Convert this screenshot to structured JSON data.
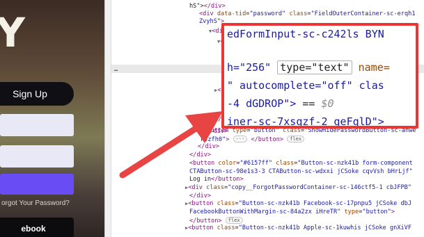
{
  "left_page": {
    "logo_text": "Y",
    "signup_label": "Sign Up",
    "forgot_label": "orgot Your Password?",
    "facebook_label": "ebook"
  },
  "devtools": {
    "lines": [
      {
        "html": "<span class='txt'>hS\"></span><span class='tag'>&lt;/div&gt;</span>"
      },
      {
        "html": "<span class='tag'>&lt;div </span><span class='attr'>data-tid</span>=<span class='val'>\"password\"</span> <span class='attr'>class</span>=<span class='val'>\"FieldOuterContainer-sc-erqh1</span>"
      },
      {
        "html": "<span class='val'>ZvyhS\"</span><span class='tag'>&gt;</span>"
      },
      {
        "html": "<span class='tri'>▼</span><span class='tag'>&lt;di</span>"
      },
      {
        "html": "<span class='tri'>▼</span><span class='tag'>&lt;di</span>"
      },
      {
        "html": "<span class='txt'>ts_</span>"
      },
      {
        "html": "<span class='txt'>hoa</span>"
      },
      {
        "html": "<span class='tag'>&lt;i</span>"
      },
      {
        "html": "<span class='txt'>…</span>"
      },
      {
        "html": "<span class='tri'>▶</span><span class='tag'>&lt;</span>"
      },
      {
        "html": "<span class='tag'>&lt;/</span>"
      },
      {
        "html": "<span class='tag'>&lt;/d</span>"
      },
      {
        "html": "<span class='tag'>&lt;/div&gt;</span>"
      }
    ],
    "lower_lines": [
      {
        "html": "<span class='tri'>▶</span><span class='tag'>&lt;button </span><span class='attr'>type</span>=<span class='val'>\"button\"</span> <span class='attr'>class</span>=<span class='val'>\"ShowHidePasswordButton-sc-anwe</span>"
      },
      {
        "html": "<span class='val'>kszfh0\"</span><span class='tag'>&gt;</span> <span class='badge'>···</span> <span class='tag'>&lt;/button&gt;</span> <span class='badge'>flex</span>"
      },
      {
        "html": "<span class='tag'>&lt;/div&gt;</span>"
      },
      {
        "html": "<span class='tag'>&lt;/div&gt;</span>"
      },
      {
        "html": "<span class='tag'>&lt;button </span><span class='attr'>color</span>=<span class='val'>\"#6157ff\"</span> <span class='attr'>class</span>=<span class='val'>\"Button-sc-nzk41b form-component</span>"
      },
      {
        "html": "<span class='val'>CTAButton-sc-98e1s3-3 CTAButton-sc-wdxxi jCSoke cqvVsh bHrLjf\"</span>"
      },
      {
        "html": "<span class='txt'>Log in</span><span class='tag'>&lt;/button&gt;</span>"
      },
      {
        "html": "<span class='tri'>▶</span><span class='tag'>&lt;div </span><span class='attr'>class</span>=<span class='val'>\"copy__ForgotPasswordContainer-sc-146ctf5-1 cbJFPB\"</span>"
      },
      {
        "html": "<span class='tag'>&lt;/div&gt;</span>"
      },
      {
        "html": "<span class='tri'>▶</span><span class='tag'>&lt;button </span><span class='attr'>class</span>=<span class='val'>\"Button-sc-nzk41b Facebook-sc-17pnpu5 jCSoke dbJ</span>"
      },
      {
        "html": "<span class='val'>FacebookButtonWithMargin-sc-84a2zx iHreTR\"</span> <span class='attr'>type</span>=<span class='val'>\"button\"</span><span class='tag'>&gt;</span>"
      },
      {
        "html": "<span class='tag'>&lt;/button&gt;</span> <span class='badge'>flex</span>"
      },
      {
        "html": "<span class='tri'>▶</span><span class='tag'>&lt;button </span><span class='attr'>class</span>=<span class='val'>\"Button-sc-nzk41b Apple-sc-1kuwhis jCSoke gnXiVF</span>"
      }
    ]
  },
  "zoom": {
    "line1": "edFormInput-sc-c242ls BYN",
    "line2_prefix": "h=\"256\" ",
    "line2_type": "type=\"text\"",
    "line2_suffix": " name=",
    "line3": "\" autocomplete=\"off\" clas",
    "line4_text": "-4 dGDROP\">",
    "line4_eq": " == ",
    "line4_dollar": "$0",
    "line5": "iner-sc-7xsqzf-2 geFqlD\">"
  },
  "colors": {
    "highlight_border": "#ec3636",
    "arrow": "#e94444",
    "tag": "#881280",
    "attr": "#994500",
    "value": "#1a1aa6",
    "login_button": "#6a4cf5"
  }
}
